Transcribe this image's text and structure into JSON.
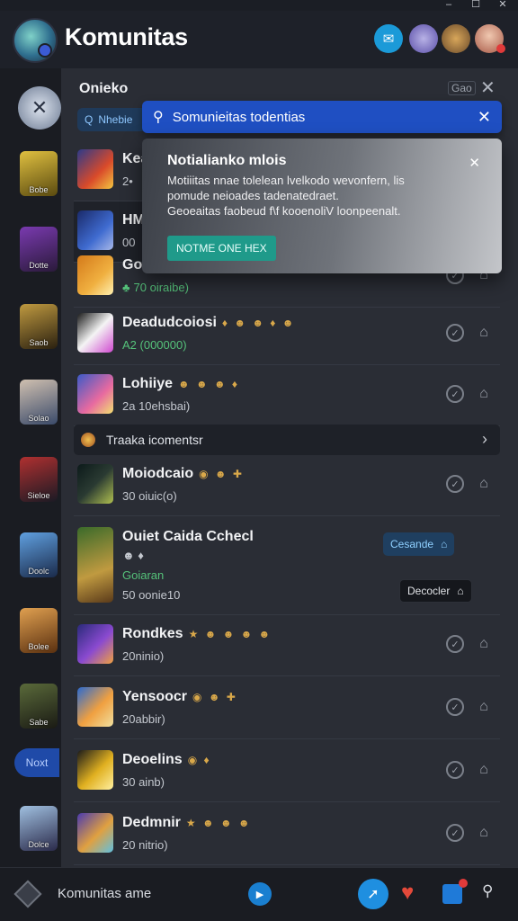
{
  "header": {
    "title": "Komunitas"
  },
  "panel": {
    "title": "Onieko",
    "tag": "Gao",
    "chip_label": "Nhebie"
  },
  "search": {
    "value": "Somunieitas todentias"
  },
  "notification": {
    "title": "Notialianko mlois",
    "body_line1": "Motiiitas nnae tolelean lvelkodo wevonfern, lis",
    "body_line2": "pomude neioades tadenatedraet.",
    "body_line3": "Geoeaitas faobeud f\\f kooenoliV loonpeenalt.",
    "button": "NOTME ONE HEX"
  },
  "rail": {
    "items": [
      {
        "label": "Bobe"
      },
      {
        "label": "Dotte"
      },
      {
        "label": "Saob"
      },
      {
        "label": "Solao"
      },
      {
        "label": "Sieloe"
      },
      {
        "label": "Doolc"
      },
      {
        "label": "Bolee"
      },
      {
        "label": "Sabe"
      },
      {
        "label": "Dolce"
      }
    ],
    "next_label": "Noxt"
  },
  "list": {
    "rows": [
      {
        "name": "Kea",
        "meta": "2•"
      },
      {
        "name": "HM",
        "meta": "00"
      },
      {
        "name": "Goi",
        "meta": "70 oiraibe)"
      },
      {
        "name": "Deadudcoiosi",
        "emoji": "♦ ☻ ☻ ♦ ☻",
        "meta": "A2 (000000)"
      },
      {
        "name": "Lohiiye",
        "emoji": "☻ ☻ ☻ ♦",
        "meta": "2a 10ehsbai)"
      },
      {
        "name": "Moiodcaio",
        "emoji": "◉ ☻ ✚",
        "meta": "30 oiuic(o)"
      },
      {
        "name": "Ouiet Caida Cchecl",
        "emoji": "☻ ♦",
        "meta1": "Goiaran",
        "meta2": "50 oonie10"
      },
      {
        "name": "Rondkes",
        "emoji": "★ ☻ ☻ ☻ ☻",
        "meta": "20ninio)"
      },
      {
        "name": "Yensoocr",
        "emoji": "◉ ☻ ✚",
        "meta": "20abbir)"
      },
      {
        "name": "Deoelins",
        "emoji": "◉ ♦",
        "meta": "30 ainb)"
      },
      {
        "name": "Dedmnir",
        "emoji": "★ ☻ ☻ ☻",
        "meta": "20 nitrio)"
      }
    ],
    "section_label": "Traaka icomentsr",
    "btn_primary": "Cesande",
    "btn_secondary": "Decocler"
  },
  "bottom": {
    "label": "Komunitas ame"
  },
  "colors": {
    "accent": "#1f4fc2",
    "panel": "#2a2d35",
    "background": "#1b1e25",
    "success": "#55c27a"
  }
}
